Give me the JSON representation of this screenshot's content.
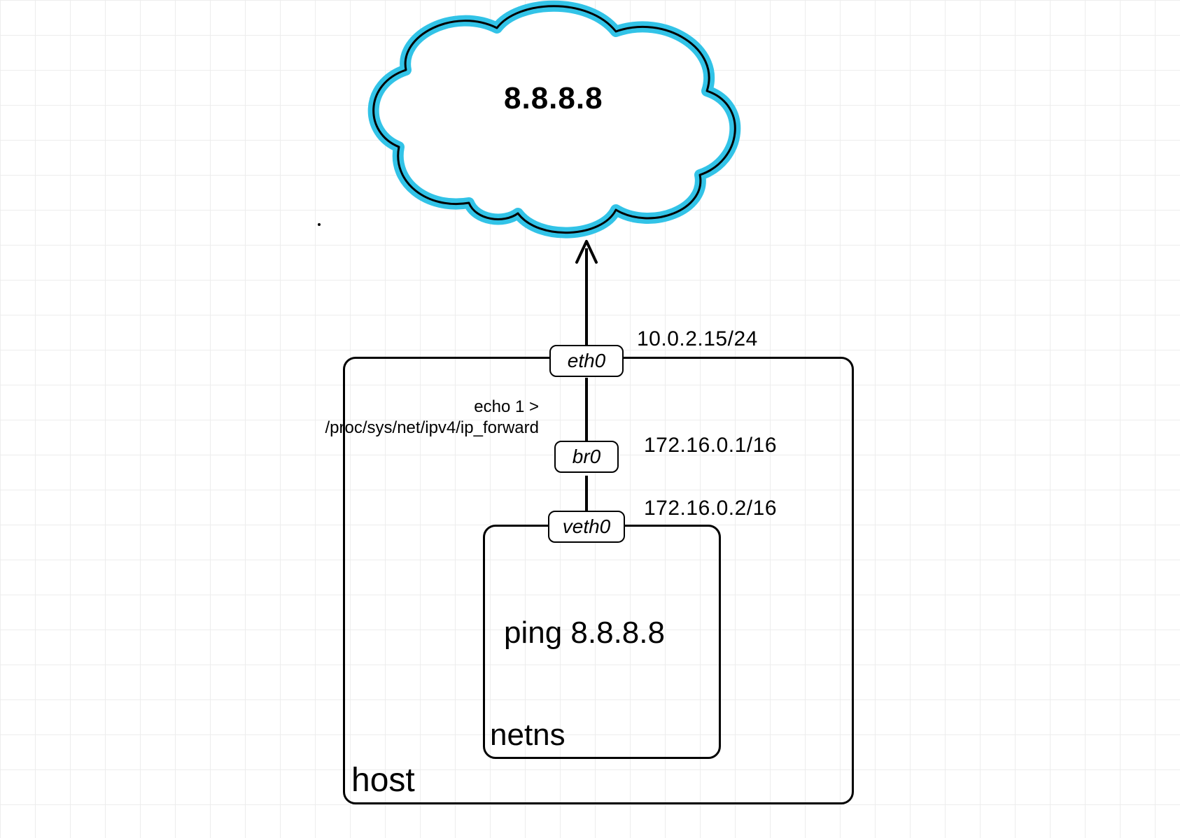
{
  "cloud": {
    "address": "8.8.8.8"
  },
  "interfaces": {
    "eth0": {
      "name": "eth0",
      "addr": "10.0.2.15/24"
    },
    "br0": {
      "name": "br0",
      "addr": "172.16.0.1/16"
    },
    "veth0": {
      "name": "veth0",
      "addr": "172.16.0.2/16"
    }
  },
  "command": {
    "line1": "echo 1 >",
    "line2": "/proc/sys/net/ipv4/ip_forward"
  },
  "netns": {
    "label": "netns",
    "ping": "ping 8.8.8.8"
  },
  "host": {
    "label": "host"
  }
}
